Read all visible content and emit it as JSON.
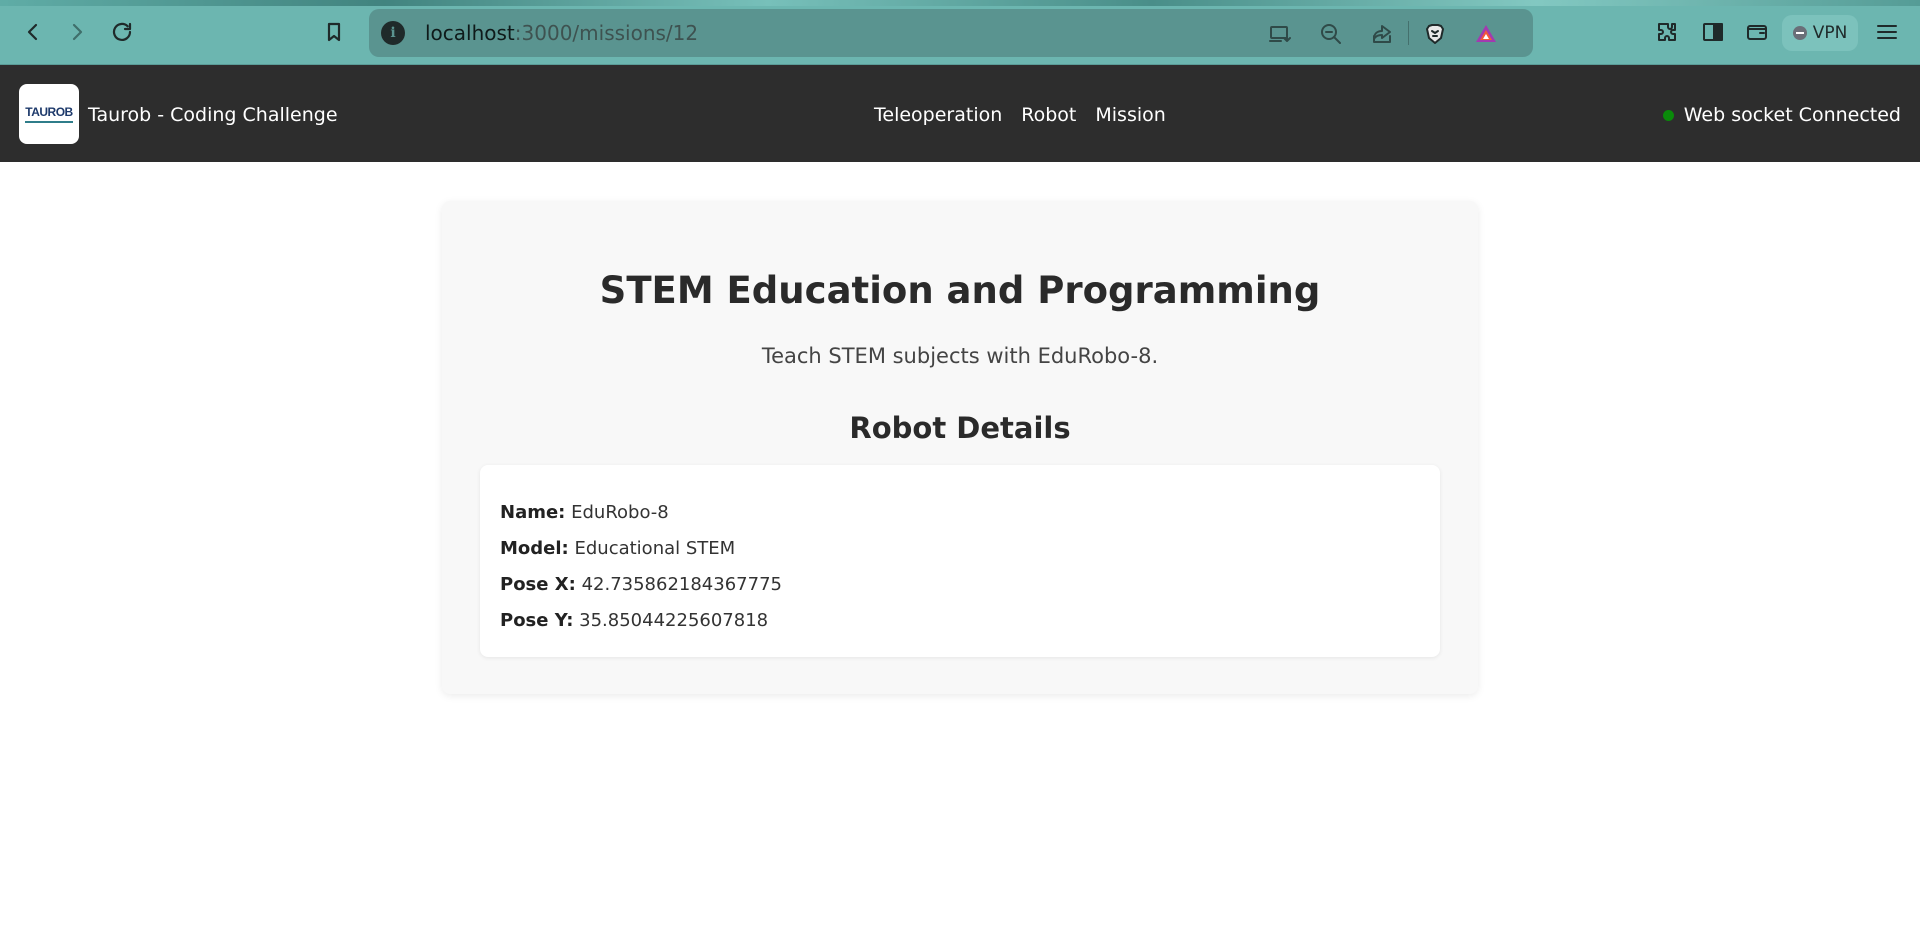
{
  "browser": {
    "url_host": "localhost",
    "url_path": ":3000/missions/12",
    "vpn_label": "VPN"
  },
  "header": {
    "logo_text": "TAUROB",
    "title": "Taurob - Coding Challenge",
    "nav": [
      {
        "label": "Teleoperation"
      },
      {
        "label": "Robot"
      },
      {
        "label": "Mission"
      }
    ],
    "status_text": "Web socket Connected",
    "status_color": "#0a8a0a"
  },
  "mission": {
    "title": "STEM Education and Programming",
    "description": "Teach STEM subjects with EduRobo-8.",
    "details_heading": "Robot Details",
    "details": [
      {
        "label": "Name:",
        "value": "EduRobo-8"
      },
      {
        "label": "Model:",
        "value": "Educational STEM"
      },
      {
        "label": "Pose X:",
        "value": "42.735862184367775"
      },
      {
        "label": "Pose Y:",
        "value": "35.85044225607818"
      }
    ]
  }
}
